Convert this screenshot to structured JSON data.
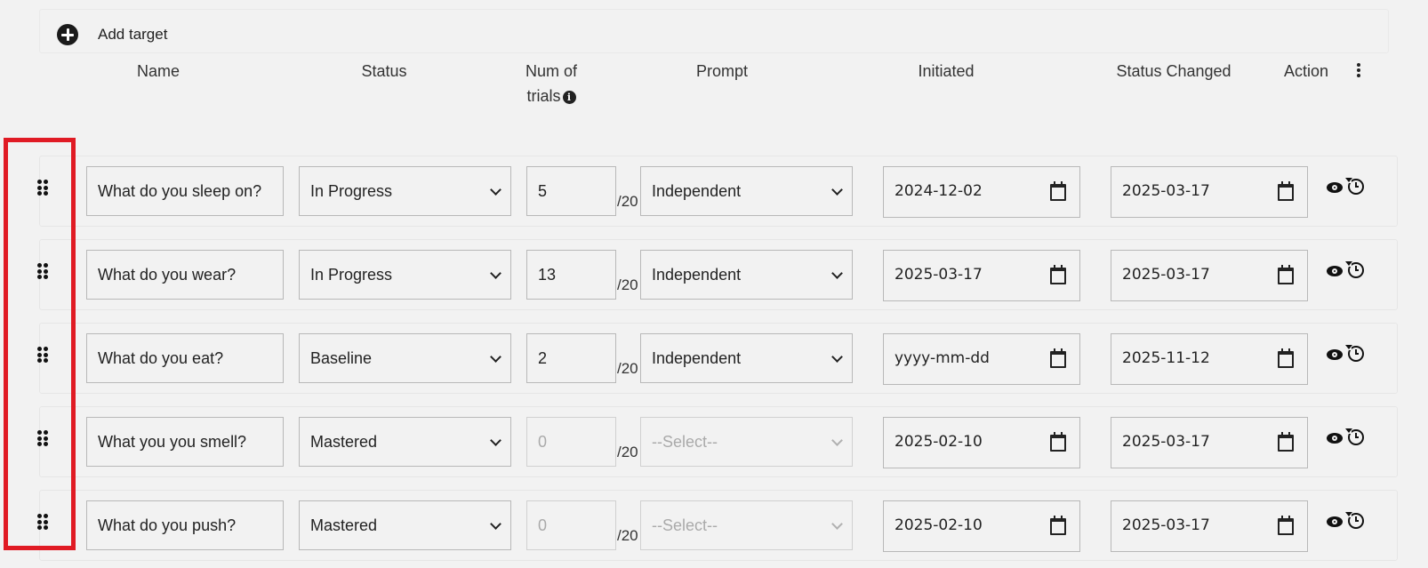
{
  "toolbar": {
    "add_label": "Add target",
    "add_icon": "plus-circle-icon"
  },
  "columns": {
    "name": "Name",
    "status": "Status",
    "trials_line1": "Num of",
    "trials_line2": "trials",
    "prompt": "Prompt",
    "initiated": "Initiated",
    "status_changed": "Status Changed",
    "action": "Action"
  },
  "trials_max": "/20",
  "rows": [
    {
      "name": "What do you sleep on?",
      "status": "In Progress",
      "trials": "5",
      "trials_disabled": false,
      "prompt": "Independent",
      "prompt_disabled": false,
      "initiated": "2024-12-02",
      "status_changed": "2025-03-17"
    },
    {
      "name": "What do you wear?",
      "status": "In Progress",
      "trials": "13",
      "trials_disabled": false,
      "prompt": "Independent",
      "prompt_disabled": false,
      "initiated": "2025-03-17",
      "status_changed": "2025-03-17"
    },
    {
      "name": "What do you eat?",
      "status": "Baseline",
      "trials": "2",
      "trials_disabled": false,
      "prompt": "Independent",
      "prompt_disabled": false,
      "initiated": "yyyy-mm-dd",
      "status_changed": "2025-11-12"
    },
    {
      "name": "What you you smell?",
      "status": "Mastered",
      "trials": "0",
      "trials_disabled": true,
      "prompt": "--Select--",
      "prompt_disabled": true,
      "initiated": "2025-02-10",
      "status_changed": "2025-03-17"
    },
    {
      "name": "What do you push?",
      "status": "Mastered",
      "trials": "0",
      "trials_disabled": true,
      "prompt": "--Select--",
      "prompt_disabled": true,
      "initiated": "2025-02-10",
      "status_changed": "2025-03-17"
    }
  ],
  "highlight_color": "#e01b24"
}
